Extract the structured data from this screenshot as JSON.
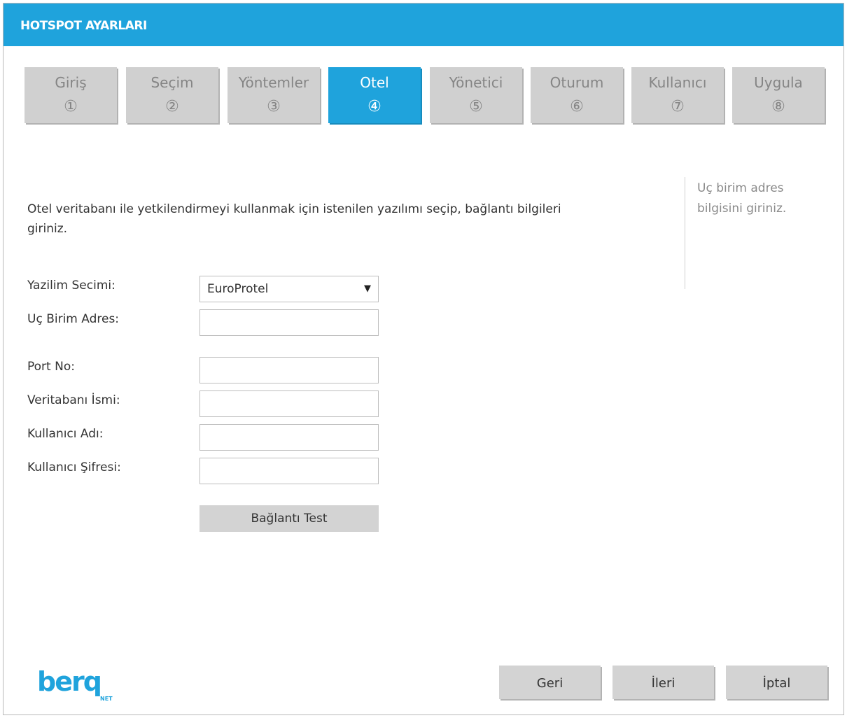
{
  "window": {
    "title": "HOTSPOT AYARLARI"
  },
  "tabs": [
    {
      "label": "Giriş",
      "number": "①",
      "active": false
    },
    {
      "label": "Seçim",
      "number": "②",
      "active": false
    },
    {
      "label": "Yöntemler",
      "number": "③",
      "active": false
    },
    {
      "label": "Otel",
      "number": "④",
      "active": true
    },
    {
      "label": "Yönetici",
      "number": "⑤",
      "active": false
    },
    {
      "label": "Oturum",
      "number": "⑥",
      "active": false
    },
    {
      "label": "Kullanıcı",
      "number": "⑦",
      "active": false
    },
    {
      "label": "Uygula",
      "number": "⑧",
      "active": false
    }
  ],
  "intro_text": "Otel veritabanı ile yetkilendirmeyi kullanmak için istenilen yazılımı seçip, bağlantı bilgileri giriniz.",
  "hint_text": "Uç birim adres bilgisini giriniz.",
  "form": {
    "software_label": "Yazilim Secimi:",
    "software_value": "EuroProtel",
    "software_caret": "▼",
    "address_label": "Uç Birim Adres:",
    "address_value": "",
    "port_label": "Port No:",
    "port_value": "",
    "database_label": "Veritabanı İsmi:",
    "database_value": "",
    "username_label": "Kullanıcı Adı:",
    "username_value": "",
    "password_label": "Kullanıcı Şifresi:",
    "password_value": "",
    "test_button": "Bağlantı Test"
  },
  "footer": {
    "back_button": "Geri",
    "next_button": "İleri",
    "cancel_button": "İptal"
  },
  "logo": {
    "text": "berq",
    "subtext": "NET"
  },
  "colors": {
    "accent": "#1fa3dc",
    "tab_inactive": "#d0d0d0",
    "button": "#d3d3d3"
  }
}
